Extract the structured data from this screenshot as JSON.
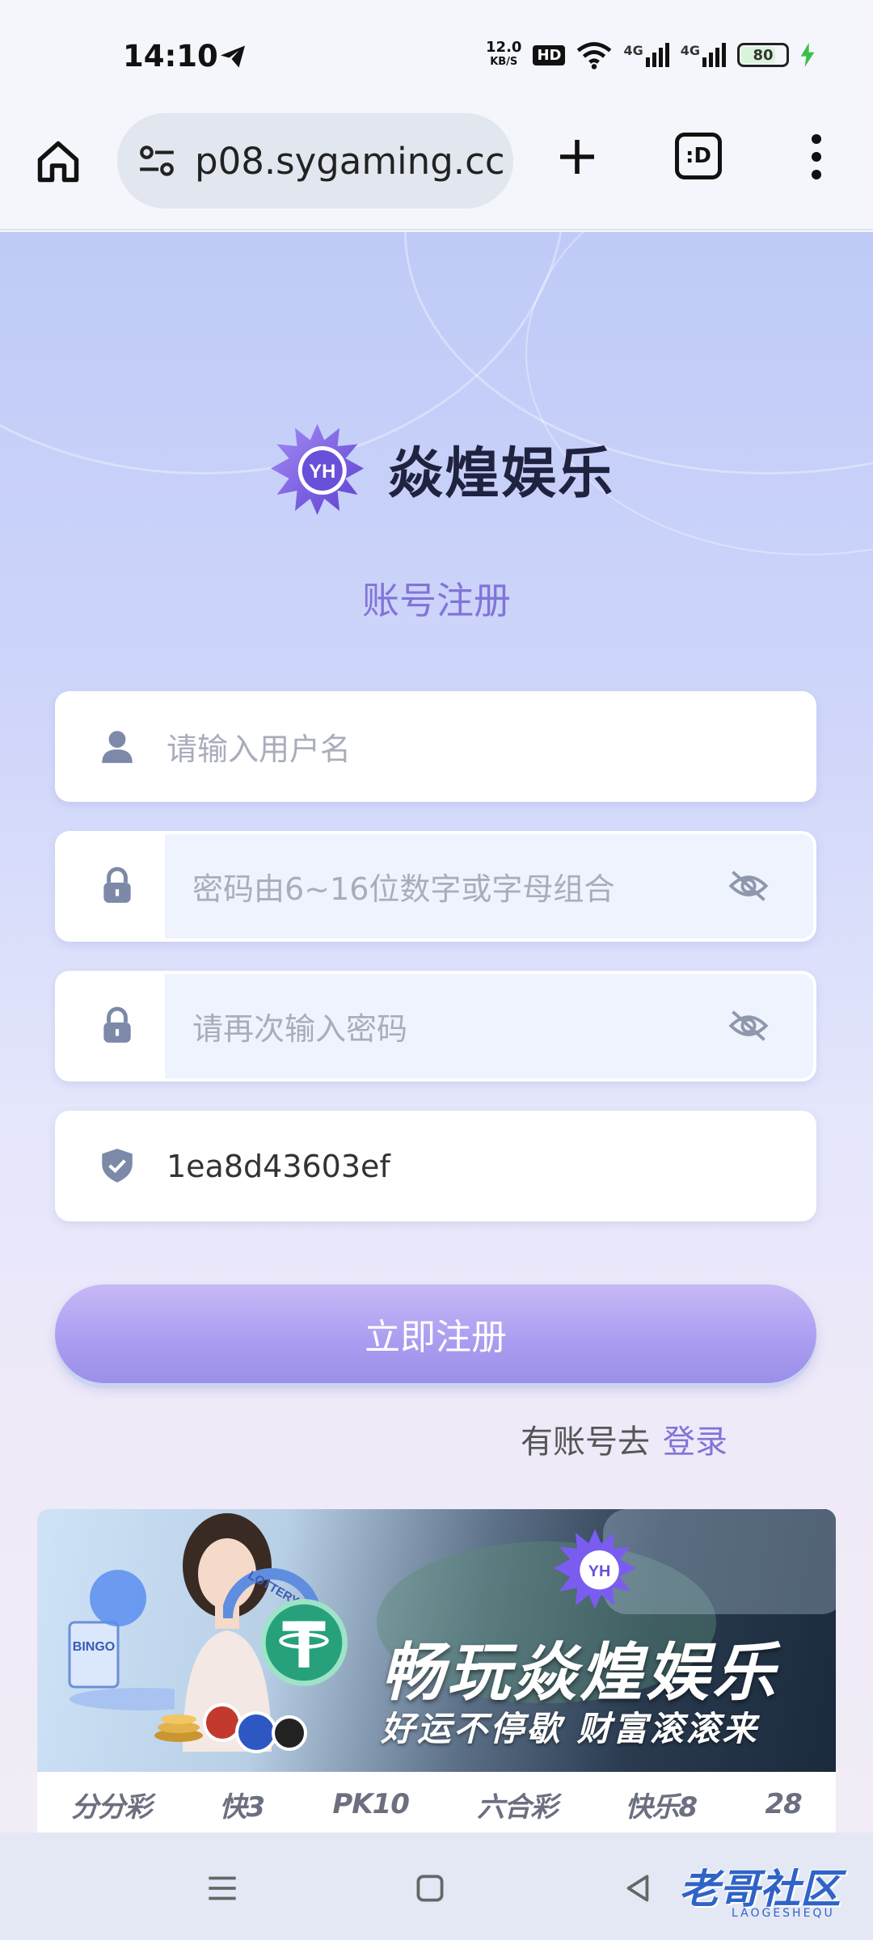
{
  "status_bar": {
    "time": "14:10",
    "net_speed_value": "12.0",
    "net_speed_unit": "KB/S",
    "hd_badge": "HD",
    "signal_1": "4G",
    "signal_2": "4G",
    "battery_level": "80",
    "battery_fraction": 0.8
  },
  "browser": {
    "url": "p08.sygaming.cc",
    "tabs_label": ":D"
  },
  "brand": {
    "name": "焱煌娱乐",
    "logo_initials": "YH",
    "accent_color": "#8274d8"
  },
  "form": {
    "title": "账号注册",
    "username_placeholder": "请输入用户名",
    "password_placeholder": "密码由6~16位数字或字母组合",
    "confirm_placeholder": "请再次输入密码",
    "invite_code": "1ea8d43603ef",
    "submit_label": "立即注册",
    "login_prompt": "有账号去",
    "login_link": "登录"
  },
  "banner": {
    "lottery_label": "LOTTERY",
    "title": "畅玩焱煌娱乐",
    "subtitle": "好运不停歇 财富滚滚来"
  },
  "games": [
    "分分彩",
    "快3",
    "PK10",
    "六合彩",
    "快乐8",
    "28"
  ],
  "watermark": {
    "text": "老哥社区",
    "sub": "LAOGESHEQU"
  }
}
